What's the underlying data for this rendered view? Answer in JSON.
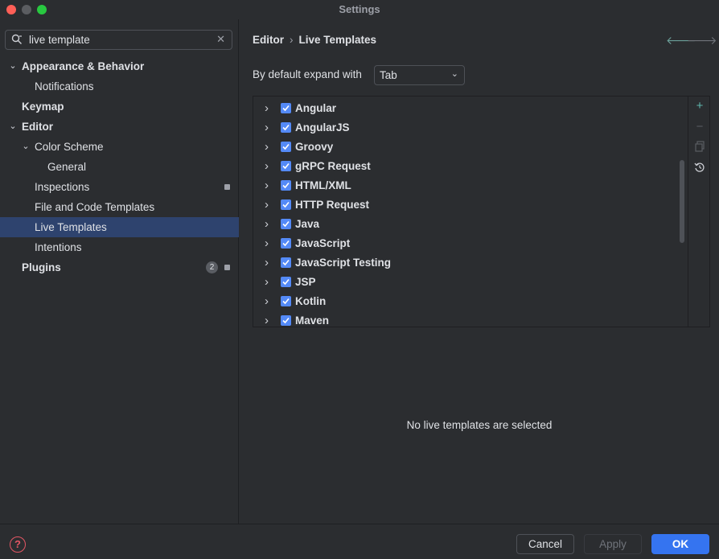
{
  "window": {
    "title": "Settings"
  },
  "search": {
    "value": "live template"
  },
  "tree": {
    "appearance": "Appearance & Behavior",
    "notifications": "Notifications",
    "keymap": "Keymap",
    "editor": "Editor",
    "color_scheme": "Color Scheme",
    "general": "General",
    "inspections": "Inspections",
    "file_code_templates": "File and Code Templates",
    "live_templates": "Live Templates",
    "intentions": "Intentions",
    "plugins": "Plugins",
    "plugins_count": "2"
  },
  "breadcrumb": {
    "parent": "Editor",
    "sep": "›",
    "current": "Live Templates"
  },
  "expand": {
    "label": "By default expand with",
    "value": "Tab"
  },
  "templates": [
    {
      "label": "Angular",
      "checked": true
    },
    {
      "label": "AngularJS",
      "checked": true
    },
    {
      "label": "Groovy",
      "checked": true
    },
    {
      "label": "gRPC Request",
      "checked": true
    },
    {
      "label": "HTML/XML",
      "checked": true
    },
    {
      "label": "HTTP Request",
      "checked": true
    },
    {
      "label": "Java",
      "checked": true
    },
    {
      "label": "JavaScript",
      "checked": true
    },
    {
      "label": "JavaScript Testing",
      "checked": true
    },
    {
      "label": "JSP",
      "checked": true
    },
    {
      "label": "Kotlin",
      "checked": true
    },
    {
      "label": "Maven",
      "checked": true
    }
  ],
  "empty_message": "No live templates are selected",
  "buttons": {
    "cancel": "Cancel",
    "apply": "Apply",
    "ok": "OK"
  },
  "colors": {
    "accent": "#3574f0",
    "selection": "#2e436e",
    "checkbox": "#548af7",
    "help": "#e55765"
  }
}
